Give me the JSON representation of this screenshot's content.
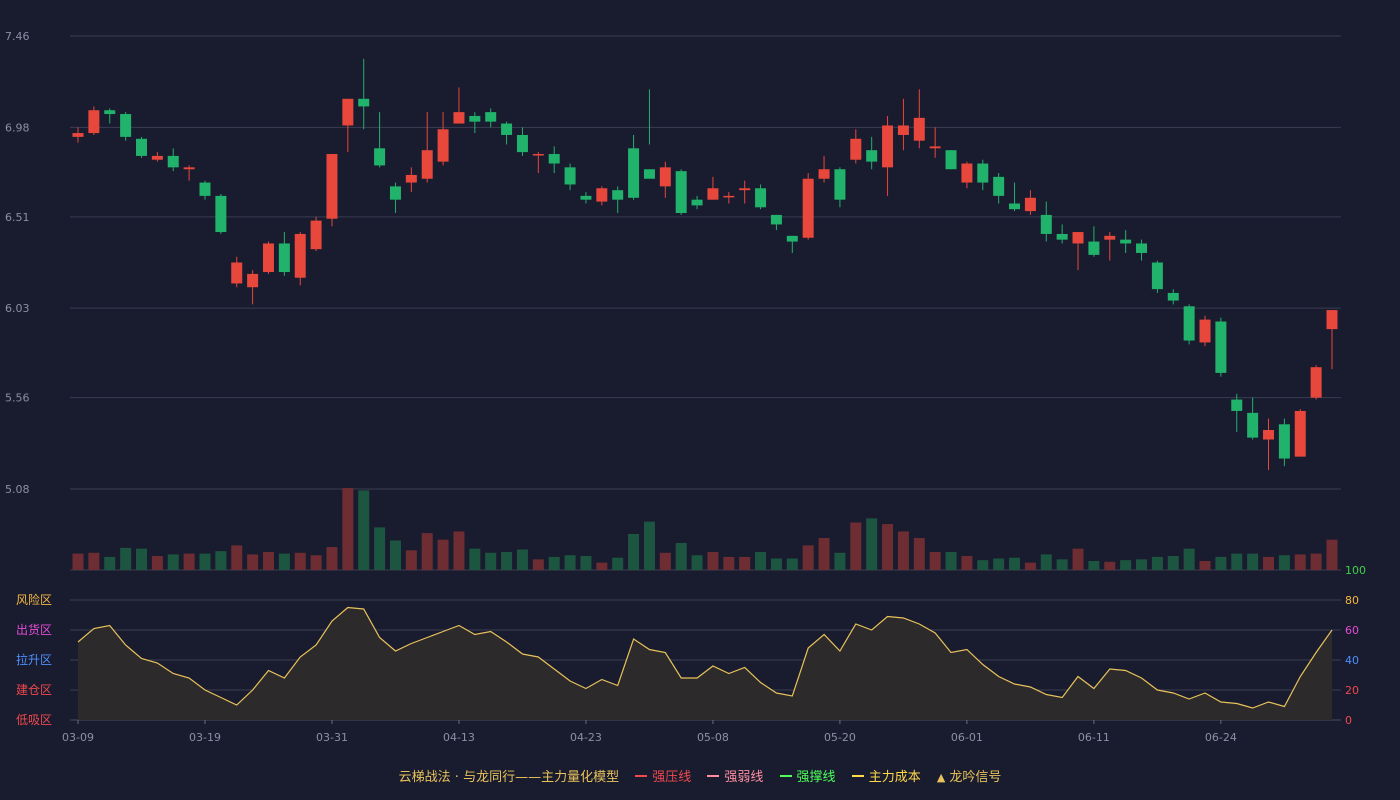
{
  "chart_data": [
    {
      "type": "candlestick",
      "y_ticks": [
        "7.46",
        "6.98",
        "6.51",
        "6.03",
        "5.56",
        "5.08"
      ],
      "ylim": [
        5.08,
        7.46
      ],
      "x_ticks": [
        "03-09",
        "03-19",
        "03-31",
        "04-13",
        "04-23",
        "05-08",
        "05-20",
        "06-01",
        "06-11",
        "06-24"
      ],
      "x_tick_index": [
        0,
        8,
        16,
        24,
        32,
        40,
        48,
        56,
        64,
        72
      ],
      "colors": {
        "up": "#e8473c",
        "down": "#21b26b"
      },
      "candles": [
        [
          6.93,
          6.95,
          6.98,
          6.9
        ],
        [
          6.95,
          7.07,
          7.09,
          6.94
        ],
        [
          7.07,
          7.05,
          7.08,
          7.0
        ],
        [
          7.05,
          6.93,
          7.06,
          6.91
        ],
        [
          6.92,
          6.83,
          6.93,
          6.82
        ],
        [
          6.81,
          6.83,
          6.85,
          6.8
        ],
        [
          6.83,
          6.77,
          6.87,
          6.75
        ],
        [
          6.76,
          6.77,
          6.78,
          6.7
        ],
        [
          6.69,
          6.62,
          6.7,
          6.6
        ],
        [
          6.62,
          6.43,
          6.63,
          6.42
        ],
        [
          6.16,
          6.27,
          6.3,
          6.14
        ],
        [
          6.14,
          6.21,
          6.23,
          6.05
        ],
        [
          6.22,
          6.37,
          6.38,
          6.21
        ],
        [
          6.37,
          6.22,
          6.43,
          6.2
        ],
        [
          6.19,
          6.42,
          6.43,
          6.15
        ],
        [
          6.34,
          6.49,
          6.51,
          6.33
        ],
        [
          6.5,
          6.84,
          6.84,
          6.46
        ],
        [
          6.99,
          7.13,
          7.13,
          6.85
        ],
        [
          7.13,
          7.09,
          7.34,
          6.97
        ],
        [
          6.87,
          6.78,
          7.06,
          6.77
        ],
        [
          6.67,
          6.6,
          6.69,
          6.53
        ],
        [
          6.69,
          6.73,
          6.77,
          6.64
        ],
        [
          6.71,
          6.86,
          7.06,
          6.69
        ],
        [
          6.8,
          6.97,
          7.06,
          6.78
        ],
        [
          7.0,
          7.06,
          7.19,
          7.0
        ],
        [
          7.04,
          7.01,
          7.06,
          6.95
        ],
        [
          7.06,
          7.01,
          7.08,
          6.98
        ],
        [
          7.0,
          6.94,
          7.01,
          6.89
        ],
        [
          6.94,
          6.85,
          6.98,
          6.83
        ],
        [
          6.84,
          6.84,
          6.85,
          6.74
        ],
        [
          6.84,
          6.79,
          6.88,
          6.74
        ],
        [
          6.77,
          6.68,
          6.79,
          6.65
        ],
        [
          6.62,
          6.6,
          6.64,
          6.58
        ],
        [
          6.59,
          6.66,
          6.67,
          6.57
        ],
        [
          6.65,
          6.6,
          6.67,
          6.53
        ],
        [
          6.87,
          6.61,
          6.94,
          6.6
        ],
        [
          6.76,
          6.71,
          7.18,
          6.89
        ],
        [
          6.67,
          6.77,
          6.8,
          6.61
        ],
        [
          6.75,
          6.53,
          6.76,
          6.52
        ],
        [
          6.6,
          6.57,
          6.62,
          6.55
        ],
        [
          6.6,
          6.66,
          6.72,
          6.6
        ],
        [
          6.62,
          6.62,
          6.64,
          6.58
        ],
        [
          6.65,
          6.66,
          6.7,
          6.58
        ],
        [
          6.66,
          6.56,
          6.68,
          6.55
        ],
        [
          6.52,
          6.47,
          6.52,
          6.44
        ],
        [
          6.41,
          6.38,
          6.41,
          6.32
        ],
        [
          6.4,
          6.71,
          6.74,
          6.39
        ],
        [
          6.71,
          6.76,
          6.83,
          6.69
        ],
        [
          6.76,
          6.6,
          6.77,
          6.56
        ],
        [
          6.81,
          6.92,
          6.97,
          6.79
        ],
        [
          6.86,
          6.8,
          6.93,
          6.76
        ],
        [
          6.77,
          6.99,
          7.04,
          6.62
        ],
        [
          6.94,
          6.99,
          7.13,
          6.86
        ],
        [
          6.91,
          7.03,
          7.18,
          6.87
        ],
        [
          6.87,
          6.88,
          6.98,
          6.82
        ],
        [
          6.86,
          6.76,
          6.86,
          6.76
        ],
        [
          6.69,
          6.79,
          6.8,
          6.66
        ],
        [
          6.79,
          6.69,
          6.81,
          6.65
        ],
        [
          6.72,
          6.62,
          6.74,
          6.58
        ],
        [
          6.58,
          6.55,
          6.69,
          6.54
        ],
        [
          6.54,
          6.61,
          6.65,
          6.52
        ],
        [
          6.52,
          6.42,
          6.59,
          6.38
        ],
        [
          6.42,
          6.39,
          6.47,
          6.37
        ],
        [
          6.37,
          6.43,
          6.43,
          6.23
        ],
        [
          6.38,
          6.31,
          6.46,
          6.3
        ],
        [
          6.39,
          6.41,
          6.43,
          6.28
        ],
        [
          6.39,
          6.37,
          6.44,
          6.32
        ],
        [
          6.37,
          6.32,
          6.39,
          6.28
        ],
        [
          6.27,
          6.13,
          6.28,
          6.11
        ],
        [
          6.11,
          6.07,
          6.13,
          6.05
        ],
        [
          6.04,
          5.86,
          6.05,
          5.84
        ],
        [
          5.85,
          5.97,
          5.99,
          5.83
        ],
        [
          5.96,
          5.69,
          5.98,
          5.67
        ],
        [
          5.55,
          5.49,
          5.58,
          5.38
        ],
        [
          5.48,
          5.35,
          5.56,
          5.34
        ],
        [
          5.34,
          5.39,
          5.45,
          5.18
        ],
        [
          5.42,
          5.24,
          5.45,
          5.2
        ],
        [
          5.25,
          5.49,
          5.5,
          5.25
        ],
        [
          5.56,
          5.72,
          5.73,
          5.55
        ],
        [
          5.92,
          6.02,
          6.02,
          5.71
        ]
      ]
    },
    {
      "type": "bar",
      "title": "volume",
      "ylim": [
        0,
        100
      ],
      "values": [
        20,
        21,
        16,
        27,
        26,
        17,
        19,
        20,
        20,
        23,
        30,
        19,
        22,
        20,
        21,
        18,
        28,
        100,
        97,
        52,
        36,
        24,
        45,
        37,
        47,
        26,
        21,
        22,
        25,
        13,
        16,
        18,
        17,
        9,
        15,
        44,
        59,
        21,
        33,
        18,
        22,
        16,
        16,
        22,
        14,
        14,
        30,
        39,
        21,
        58,
        63,
        56,
        47,
        39,
        22,
        22,
        17,
        12,
        14,
        15,
        9,
        19,
        13,
        26,
        11,
        10,
        12,
        13,
        16,
        17,
        26,
        11,
        16,
        20,
        20,
        16,
        18,
        19,
        20,
        37
      ],
      "up_days_from_candles": true
    },
    {
      "type": "area",
      "zones": [
        "风险区",
        "出货区",
        "拉升区",
        "建仓区",
        "低吸区"
      ],
      "zone_colors": [
        "#f5b842",
        "#e24cd6",
        "#4e90ff",
        "#f0494e",
        "#f0494e"
      ],
      "right_ticks": [
        "100",
        "80",
        "60",
        "40",
        "20",
        "0"
      ],
      "right_tick_colors": [
        "#3ecf49",
        "#f5b842",
        "#e24cd6",
        "#4e90ff",
        "#f0494e",
        "#f0494e"
      ],
      "ylim": [
        0,
        100
      ],
      "values": [
        52,
        61,
        63,
        50,
        41,
        38,
        31,
        28,
        20,
        15,
        10,
        20,
        33,
        28,
        42,
        50,
        66,
        75,
        74,
        55,
        46,
        51,
        55,
        59,
        63,
        57,
        59,
        52,
        44,
        42,
        34,
        26,
        21,
        27,
        23,
        54,
        47,
        45,
        28,
        28,
        36,
        31,
        35,
        25,
        18,
        16,
        48,
        57,
        46,
        64,
        60,
        69,
        68,
        64,
        58,
        45,
        47,
        37,
        29,
        24,
        22,
        17,
        15,
        29,
        21,
        34,
        33,
        28,
        20,
        18,
        14,
        18,
        12,
        11,
        8,
        12,
        9,
        29,
        45,
        60
      ],
      "line_color": "#e8c25a"
    }
  ],
  "legend": {
    "model": "云梯战法 · 与龙同行——主力量化模型",
    "items": [
      {
        "label": "强压线",
        "color": "#f0494e",
        "style": "solid"
      },
      {
        "label": "强弱线",
        "color": "#ff8fa0",
        "style": "dashed"
      },
      {
        "label": "强撑线",
        "color": "#4dff58",
        "style": "solid"
      },
      {
        "label": "主力成本",
        "color": "#ffd84a",
        "style": "dashed"
      },
      {
        "label": "龙吟信号",
        "color": "#e8c25a",
        "style": "triangle"
      }
    ]
  }
}
